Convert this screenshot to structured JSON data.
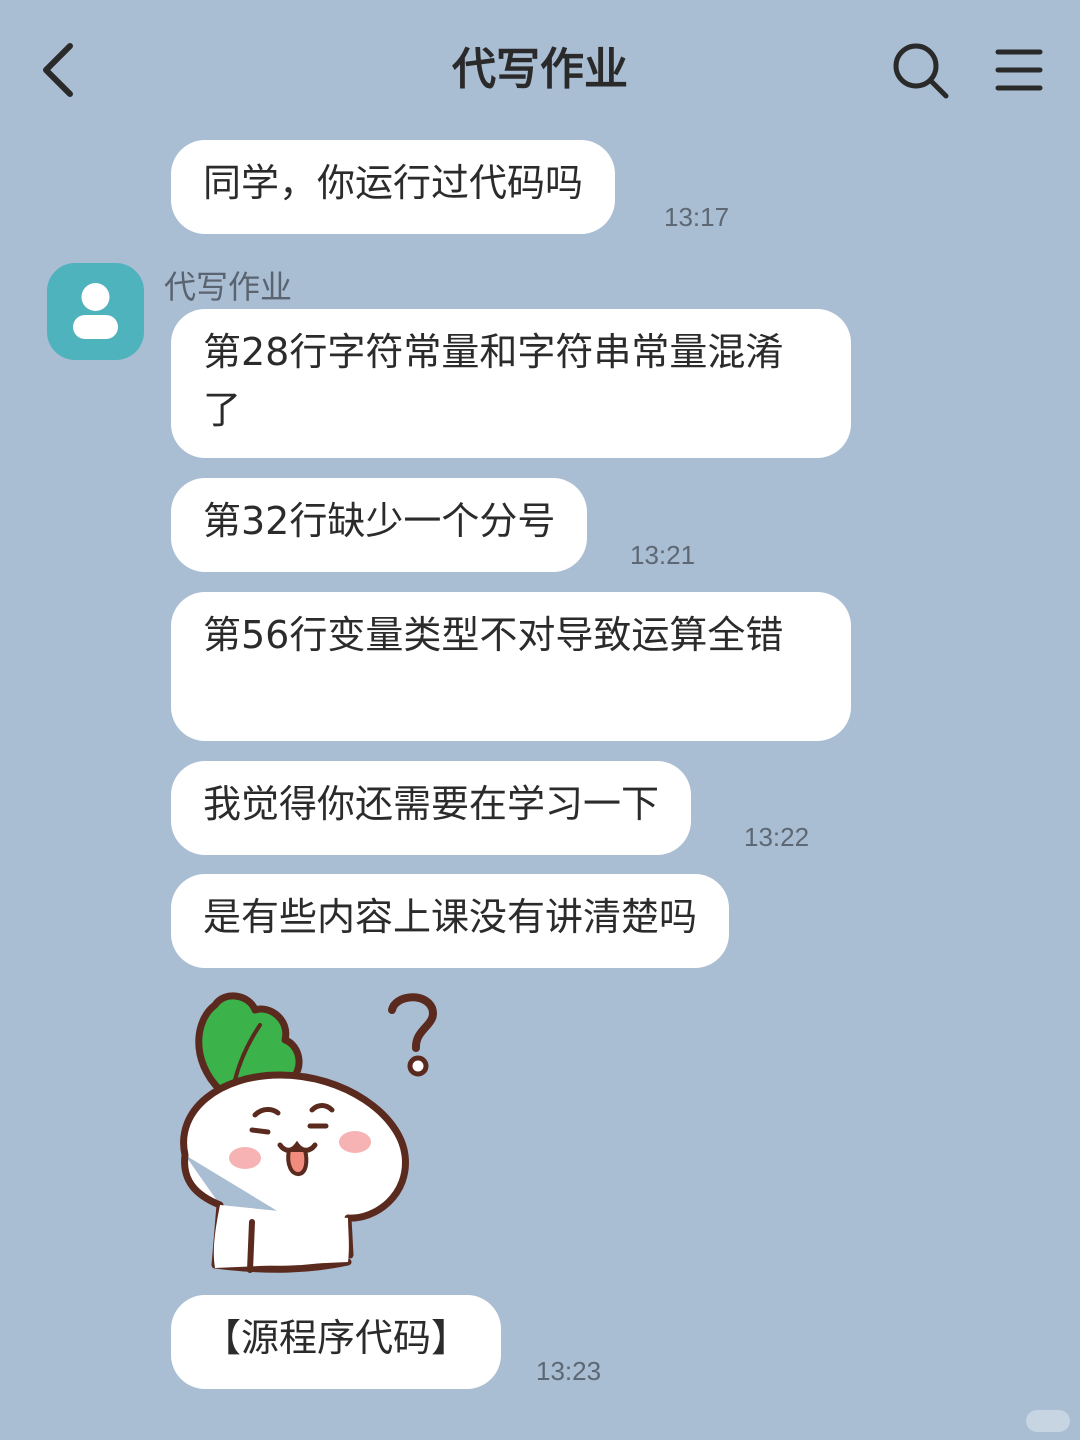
{
  "header": {
    "title": "代写作业",
    "back_icon": "chevron-left-icon",
    "search_icon": "search-icon",
    "menu_icon": "hamburger-menu-icon"
  },
  "chat": {
    "sender_name": "代写作业",
    "avatar_icon": "person-icon",
    "messages": [
      {
        "text": "同学，你运行过代码吗",
        "time": "13:17"
      },
      {
        "text": "第28行字符常量和字符串常量混淆了",
        "time": ""
      },
      {
        "text": "第32行缺少一个分号",
        "time": "13:21"
      },
      {
        "text": "第56行变量类型不对导致运算全错",
        "time": ""
      },
      {
        "text": "我觉得你还需要在学习一下",
        "time": "13:22"
      },
      {
        "text": "是有些内容上课没有讲清楚吗",
        "time": ""
      },
      {
        "sticker": "confused-radish-sticker"
      },
      {
        "text": "【源程序代码】",
        "time": "13:23"
      }
    ]
  },
  "colors": {
    "background": "#a9bdd3",
    "bubble": "#ffffff",
    "avatar": "#4fb3bd",
    "sticker_leaf": "#3cb24a",
    "sticker_outline": "#5b2a1e"
  }
}
